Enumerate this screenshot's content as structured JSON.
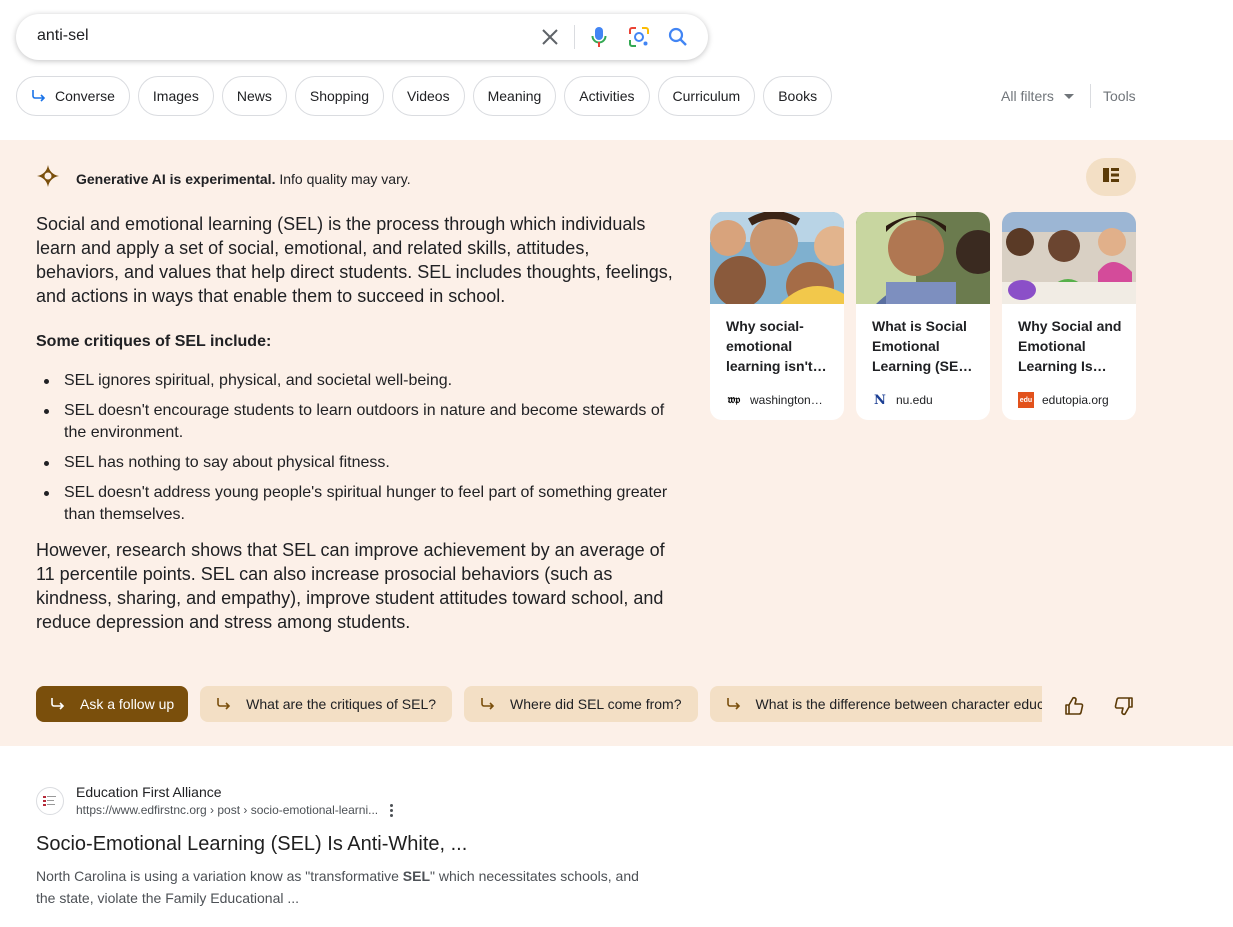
{
  "search": {
    "query": "anti-sel",
    "icons": [
      "close-icon",
      "mic-icon",
      "lens-icon",
      "search-icon"
    ]
  },
  "chips": [
    {
      "label": "Converse",
      "icon": "converse-arrow-icon"
    },
    {
      "label": "Images"
    },
    {
      "label": "News"
    },
    {
      "label": "Shopping"
    },
    {
      "label": "Videos"
    },
    {
      "label": "Meaning"
    },
    {
      "label": "Activities"
    },
    {
      "label": "Curriculum"
    },
    {
      "label": "Books"
    }
  ],
  "toolbar": {
    "all_filters": "All filters",
    "tools": "Tools"
  },
  "ai": {
    "header_bold": "Generative AI is experimental.",
    "header_rest": " Info quality may vary.",
    "intro": "Social and emotional learning (SEL) is the process through which individuals learn and apply a set of social, emotional, and related skills, attitudes, behaviors, and values that help direct students. SEL includes thoughts, feelings, and actions in ways that enable them to succeed in school.",
    "subheading": "Some critiques of SEL include:",
    "critiques": [
      "SEL ignores spiritual, physical, and societal well-being.",
      "SEL doesn't encourage students to learn outdoors in nature and become stewards of the environment.",
      "SEL has nothing to say about physical fitness.",
      "SEL doesn't address young people's spiritual hunger to feel part of something greater than themselves."
    ],
    "closing": "However, research shows that SEL can improve achievement by an average of 11 percentile points. SEL can also increase prosocial behaviors (such as kindness, sharing, and empathy), improve student attitudes toward school, and reduce depression and stress among students.",
    "cards": [
      {
        "title": "Why social-emotional learning isn't…",
        "source": "washington…",
        "favicon": "wp"
      },
      {
        "title": "What is Social Emotional Learning (SE…",
        "source": "nu.edu",
        "favicon": "N"
      },
      {
        "title": "Why Social and Emotional Learning Is…",
        "source": "edutopia.org",
        "favicon": "edu"
      }
    ],
    "ask_followup": "Ask a follow up",
    "followups": [
      "What are the critiques of SEL?",
      "Where did SEL come from?",
      "What is the difference between character education and SEL?"
    ]
  },
  "result": {
    "site_name": "Education First Alliance",
    "url": "https://www.edfirstnc.org › post › socio-emotional-learni...",
    "title": "Socio-Emotional Learning (SEL) Is Anti-White, ...",
    "snippet_before": "North Carolina is using a variation know as \"transformative ",
    "snippet_bold": "SEL",
    "snippet_after": "\" which necessitates schools, and the state, violate the Family Educational ..."
  },
  "colors": {
    "ai_background": "#fcf0e8",
    "ai_accent": "#7a4f0c",
    "chip_tan": "#f3dfc5",
    "link_blue": "#1a73e8"
  }
}
